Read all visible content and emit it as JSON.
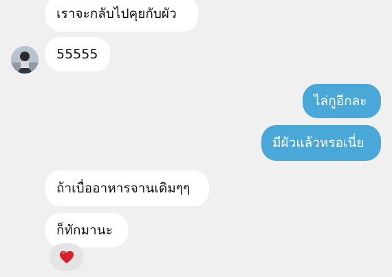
{
  "conversation": {
    "messages": [
      {
        "direction": "incoming",
        "text": "เราจะกลับไปคุยกับผัว"
      },
      {
        "direction": "incoming",
        "text": "55555"
      },
      {
        "direction": "outgoing",
        "text": "ไล่กูอีกละ"
      },
      {
        "direction": "outgoing",
        "text": "มีผัวแล้วหรอเนี่ย"
      },
      {
        "direction": "incoming",
        "text": "ถ้าเบื่ออาหารจานเดิมๆๆ"
      },
      {
        "direction": "incoming",
        "text": "ก็ทักมานะ"
      }
    ],
    "reaction": {
      "emoji": "❤️",
      "name": "heart-icon"
    }
  },
  "colors": {
    "background": "#f0f0f0",
    "incoming_bubble": "#ffffff",
    "outgoing_bubble": "#4aa8d8",
    "reaction_pill": "#e4e4e4",
    "heart": "#d7202a"
  }
}
